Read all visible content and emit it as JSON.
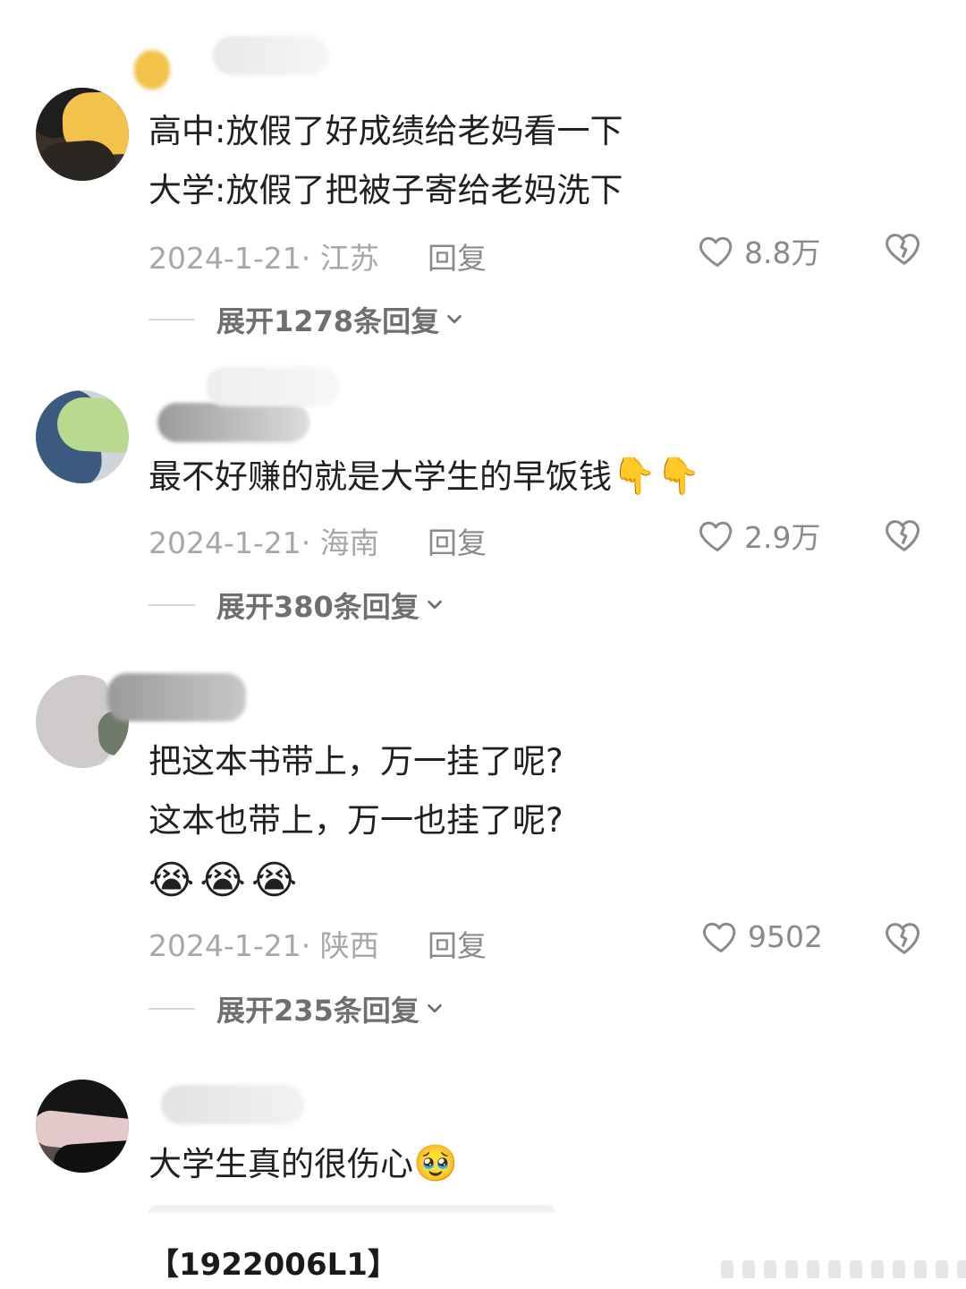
{
  "comments": [
    {
      "lines": [
        "高中:放假了好成绩给老妈看一下",
        "大学:放假了把被子寄给老妈洗下"
      ],
      "date": "2024-1-21",
      "location": "江苏",
      "reply_label": "回复",
      "likes": "8.8万",
      "expand_label": "展开1278条回复",
      "avatar_colors": [
        "#2a2a2a",
        "#f2c24a"
      ]
    },
    {
      "lines": [
        "最不好赚的就是大学生的早饭钱"
      ],
      "emoji": "👇👇",
      "date": "2024-1-21",
      "location": "海南",
      "reply_label": "回复",
      "likes": "2.9万",
      "expand_label": "展开380条回复",
      "avatar_colors": [
        "#3a5a80",
        "#b9d98e"
      ]
    },
    {
      "lines": [
        "把这本书带上，万一挂了呢?",
        "这本也带上，万一也挂了呢?"
      ],
      "emoji": "😭😭😭",
      "date": "2024-1-21",
      "location": "陕西",
      "reply_label": "回复",
      "likes": "9502",
      "expand_label": "展开235条回复",
      "avatar_colors": [
        "#cfcaca",
        "#9a9a9a"
      ]
    },
    {
      "lines": [
        "大学生真的很伤心"
      ],
      "emoji": "🥹",
      "avatar_colors": [
        "#151515",
        "#e3c9c9"
      ]
    }
  ],
  "quote_card": {
    "text": "【1922006L1】"
  },
  "icons": {
    "like": "heart-outline-icon",
    "dislike": "broken-heart-icon",
    "expand": "chevron-down-icon"
  }
}
